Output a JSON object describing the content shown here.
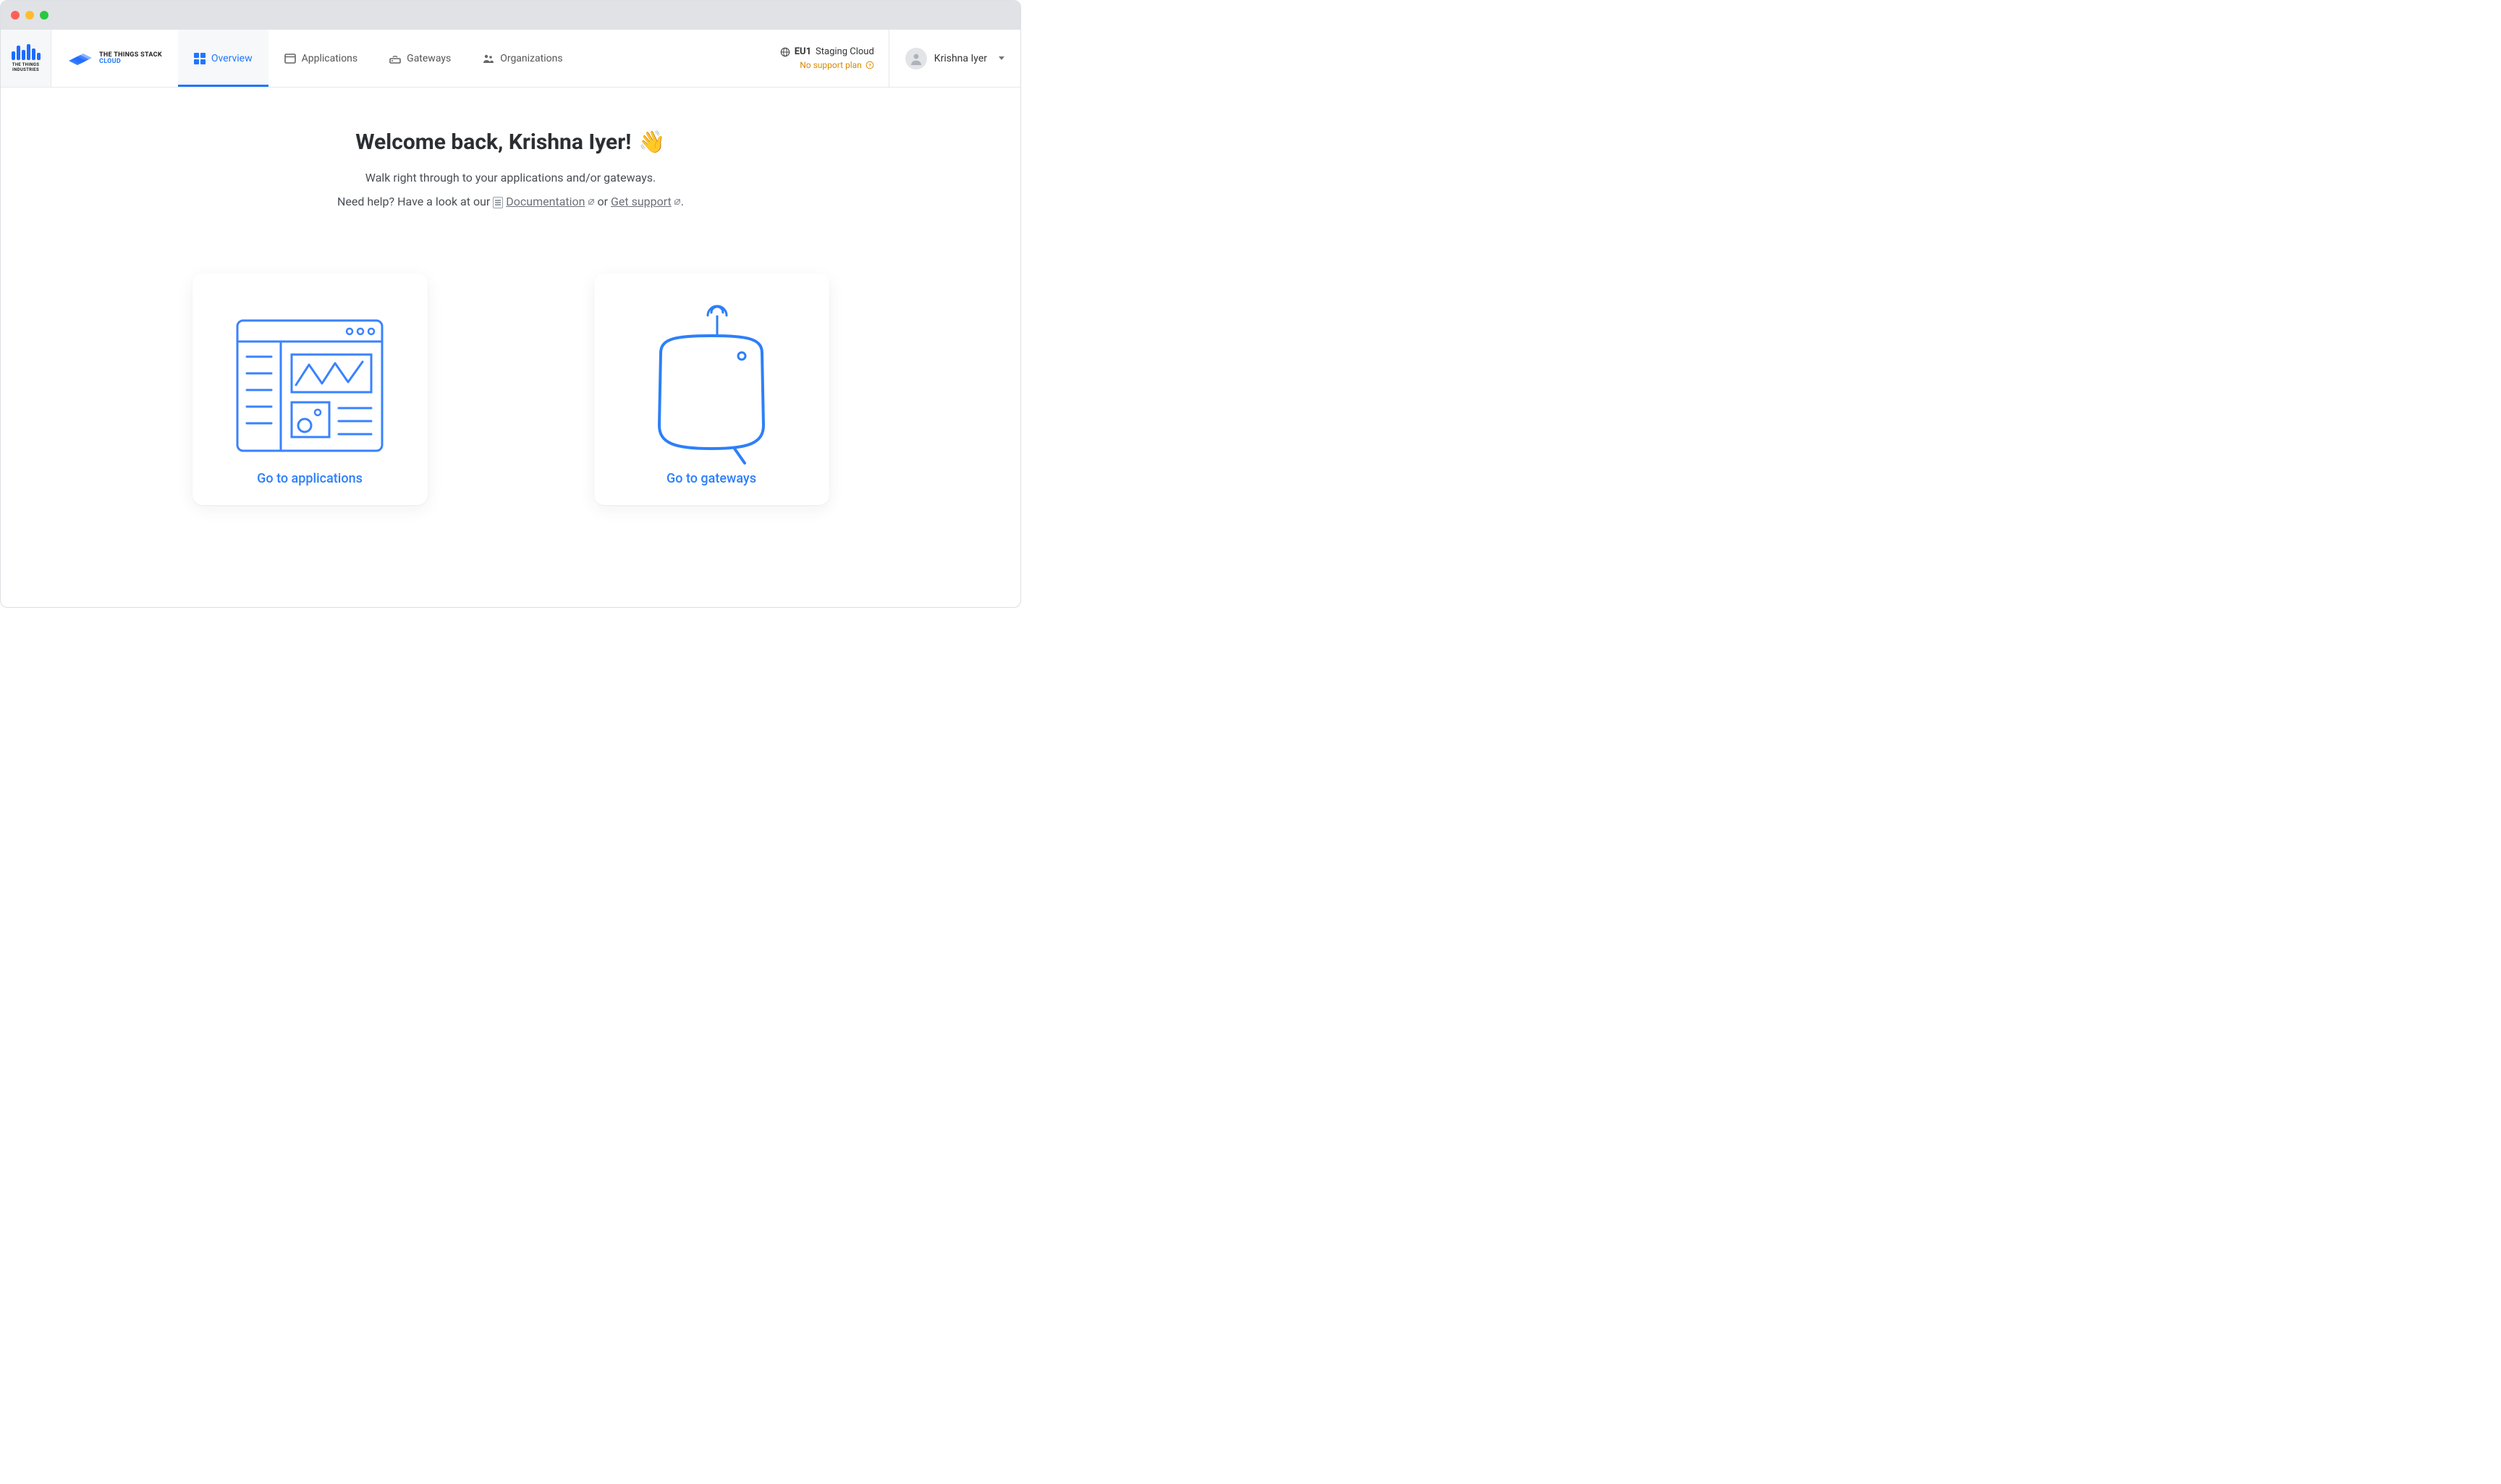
{
  "brand": {
    "sidebar_name": "THE THINGS INDUSTRIES",
    "stack_line1": "THE THINGS STACK",
    "stack_line2": "CLOUD"
  },
  "nav": {
    "items": [
      {
        "label": "Overview"
      },
      {
        "label": "Applications"
      },
      {
        "label": "Gateways"
      },
      {
        "label": "Organizations"
      }
    ]
  },
  "cluster": {
    "region": "EU1",
    "name": "Staging Cloud",
    "support_text": "No support plan"
  },
  "user": {
    "name": "Krishna Iyer"
  },
  "main": {
    "welcome": "Welcome back, Krishna Iyer!",
    "wave": "👋",
    "subtitle": "Walk right through to your applications and/or gateways.",
    "help_prefix": "Need help? Have a look at our ",
    "doc_link": "Documentation",
    "help_mid": " or ",
    "support_link": "Get support",
    "help_suffix": "."
  },
  "cards": {
    "apps": {
      "label": "Go to applications"
    },
    "gateways": {
      "label": "Go to gateways"
    }
  }
}
